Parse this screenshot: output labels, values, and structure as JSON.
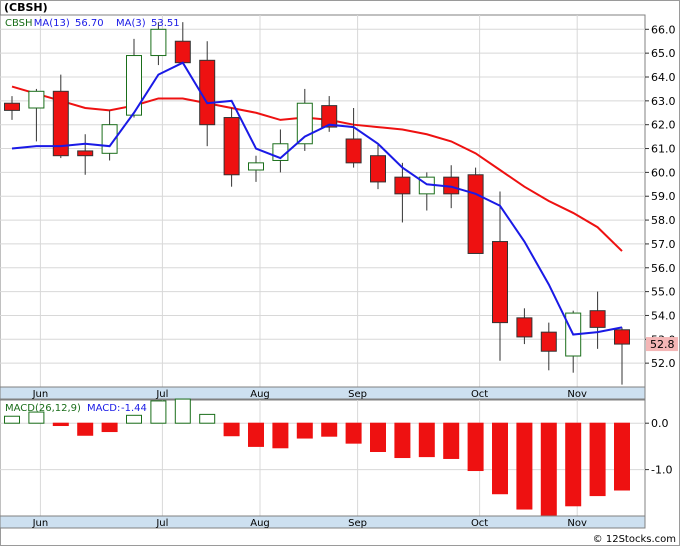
{
  "ticker_label": "(CBSH)",
  "watermark": "© 12Stocks.com",
  "colors": {
    "up_candle": "#1a6e1a",
    "down_candle": "#ee1111",
    "ma13": "#ee1111",
    "ma3": "#1a1ae6",
    "macd_pos_fill": "#ffffff",
    "macd_pos_stroke": "#1a6e1a",
    "macd_neg": "#ee1111",
    "grid": "#d8d8d8",
    "axis_band": "#cde0f0",
    "last_price_bg": "#f4b6b6"
  },
  "chart_data": [
    {
      "type": "candlestick",
      "title": "",
      "legend": [
        {
          "name": "CBSH",
          "value": "",
          "color": "#1a6e1a"
        },
        {
          "name": "MA(13)",
          "value": "56.70",
          "color": "#1a1ae6"
        },
        {
          "name": "MA(3)",
          "value": "53.51",
          "color": "#1a1ae6"
        }
      ],
      "ylim": [
        51.0,
        66.6
      ],
      "yticks": [
        52.0,
        53.0,
        54.0,
        55.0,
        56.0,
        57.0,
        58.0,
        59.0,
        60.0,
        61.0,
        62.0,
        63.0,
        64.0,
        65.0,
        66.0
      ],
      "ytick_labels": [
        "52.0",
        "53.0",
        "54.0",
        "55.0",
        "56.0",
        "57.0",
        "58.0",
        "59.0",
        "60.0",
        "61.0",
        "62.0",
        "63.0",
        "64.0",
        "65.0",
        "66.0"
      ],
      "x_labels": [
        {
          "label": "Jun",
          "index": 1
        },
        {
          "label": "Jul",
          "index": 6
        },
        {
          "label": "Aug",
          "index": 10
        },
        {
          "label": "Sep",
          "index": 14
        },
        {
          "label": "Oct",
          "index": 19
        },
        {
          "label": "Nov",
          "index": 23
        }
      ],
      "last_price": "52.8",
      "candles": [
        {
          "o": 62.9,
          "h": 63.2,
          "l": 62.2,
          "c": 62.6
        },
        {
          "o": 62.7,
          "h": 63.5,
          "l": 61.3,
          "c": 63.4
        },
        {
          "o": 63.4,
          "h": 64.1,
          "l": 60.6,
          "c": 60.7
        },
        {
          "o": 60.9,
          "h": 61.6,
          "l": 59.9,
          "c": 60.7
        },
        {
          "o": 60.8,
          "h": 62.6,
          "l": 60.5,
          "c": 62.0
        },
        {
          "o": 62.4,
          "h": 65.6,
          "l": 62.3,
          "c": 64.9
        },
        {
          "o": 64.9,
          "h": 66.3,
          "l": 64.5,
          "c": 66.0
        },
        {
          "o": 65.5,
          "h": 66.3,
          "l": 64.6,
          "c": 64.6
        },
        {
          "o": 64.7,
          "h": 65.5,
          "l": 61.1,
          "c": 62.0
        },
        {
          "o": 62.3,
          "h": 62.7,
          "l": 59.4,
          "c": 59.9
        },
        {
          "o": 60.1,
          "h": 60.7,
          "l": 59.6,
          "c": 60.4
        },
        {
          "o": 60.5,
          "h": 61.8,
          "l": 60.0,
          "c": 61.2
        },
        {
          "o": 61.2,
          "h": 63.5,
          "l": 60.9,
          "c": 62.9
        },
        {
          "o": 62.8,
          "h": 63.2,
          "l": 61.7,
          "c": 61.9
        },
        {
          "o": 61.4,
          "h": 62.7,
          "l": 60.2,
          "c": 60.4
        },
        {
          "o": 60.7,
          "h": 61.2,
          "l": 59.3,
          "c": 59.6
        },
        {
          "o": 59.8,
          "h": 60.4,
          "l": 57.9,
          "c": 59.1
        },
        {
          "o": 59.1,
          "h": 60.0,
          "l": 58.4,
          "c": 59.8
        },
        {
          "o": 59.8,
          "h": 60.3,
          "l": 58.5,
          "c": 59.1
        },
        {
          "o": 59.9,
          "h": 60.2,
          "l": 56.6,
          "c": 56.6
        },
        {
          "o": 57.1,
          "h": 59.2,
          "l": 52.1,
          "c": 53.7
        },
        {
          "o": 53.9,
          "h": 54.3,
          "l": 52.8,
          "c": 53.1
        },
        {
          "o": 53.3,
          "h": 53.7,
          "l": 51.7,
          "c": 52.5
        },
        {
          "o": 52.3,
          "h": 54.2,
          "l": 51.6,
          "c": 54.1
        },
        {
          "o": 54.2,
          "h": 55.0,
          "l": 52.6,
          "c": 53.5
        },
        {
          "o": 53.4,
          "h": 53.5,
          "l": 51.1,
          "c": 52.8
        }
      ],
      "ma13": [
        63.6,
        63.3,
        63.0,
        62.7,
        62.6,
        62.8,
        63.1,
        63.1,
        62.9,
        62.7,
        62.5,
        62.2,
        62.3,
        62.2,
        62.0,
        61.9,
        61.8,
        61.6,
        61.3,
        60.8,
        60.1,
        59.4,
        58.8,
        58.3,
        57.7,
        56.7
      ],
      "ma3": [
        61.0,
        61.1,
        61.1,
        61.2,
        61.1,
        62.5,
        64.1,
        64.6,
        62.9,
        63.0,
        61.0,
        60.6,
        61.5,
        62.0,
        61.9,
        61.2,
        60.2,
        59.5,
        59.4,
        59.1,
        58.6,
        57.1,
        55.3,
        53.2,
        53.3,
        53.5
      ],
      "ma3_start": 0,
      "ma13_start": 0
    },
    {
      "type": "bar",
      "title": "",
      "legend": [
        {
          "name": "MACD(26,12,9)",
          "value": "",
          "color": "#1a6e1a"
        },
        {
          "name": "MACD:",
          "value": "-1.44",
          "color": "#1a1ae6"
        }
      ],
      "ylim": [
        -2.0,
        0.5
      ],
      "yticks": [
        0.0,
        -1.0
      ],
      "ytick_labels": [
        "0.0",
        "-1.0"
      ],
      "values": [
        0.15,
        0.24,
        -0.05,
        -0.26,
        -0.18,
        0.17,
        0.48,
        0.52,
        0.19,
        -0.27,
        -0.5,
        -0.53,
        -0.32,
        -0.28,
        -0.43,
        -0.61,
        -0.74,
        -0.72,
        -0.76,
        -1.02,
        -1.52,
        -1.85,
        -1.98,
        -1.78,
        -1.56,
        -1.44
      ]
    }
  ]
}
